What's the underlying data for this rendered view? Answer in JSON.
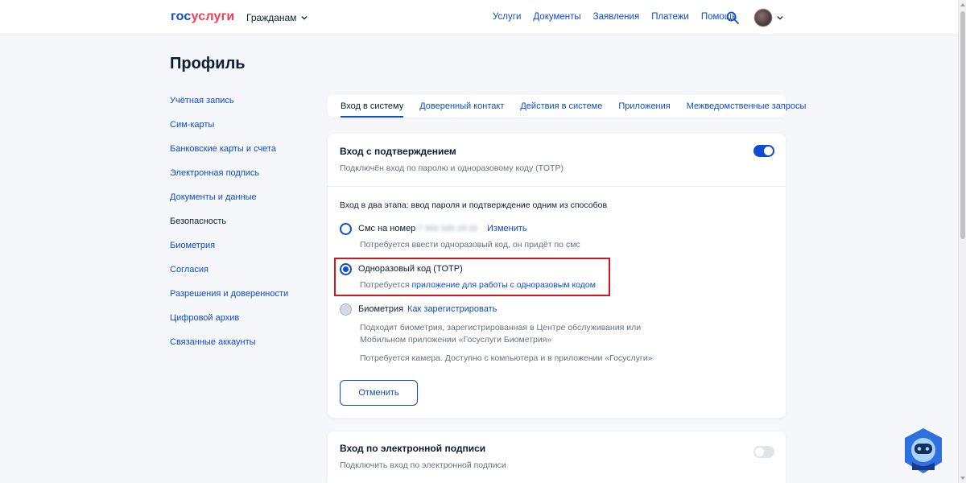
{
  "header": {
    "logo_part1": "гос",
    "logo_part2": "услуги",
    "audience": "Гражданам",
    "nav": [
      "Услуги",
      "Документы",
      "Заявления",
      "Платежи",
      "Помощь"
    ],
    "icons": {
      "search": "search-icon",
      "chevron": "chevron-down-icon",
      "avatar": "avatar"
    }
  },
  "page": {
    "title": "Профиль"
  },
  "sidebar": {
    "items": [
      "Учётная запись",
      "Сим-карты",
      "Банковские карты и счета",
      "Электронная подпись",
      "Документы и данные",
      "Безопасность",
      "Биометрия",
      "Согласия",
      "Разрешения и доверенности",
      "Цифровой архив",
      "Связанные аккаунты"
    ],
    "active_index": 5
  },
  "tabs": [
    "Вход в систему",
    "Доверенный контакт",
    "Действия в системе",
    "Приложения",
    "Межведомственные запросы"
  ],
  "active_tab": 0,
  "two_factor": {
    "title": "Вход с подтверждением",
    "subtitle": "Подключён вход по паролю и одноразовому коду (TOTP)",
    "enabled": true,
    "intro": "Вход в два этапа: ввод пароля и подтверждение одним из способов",
    "sms": {
      "label": "Смс на номер",
      "phone": "+7 900 349-18-33",
      "change_link": "Изменить",
      "note": "Потребуется ввести одноразовый код, он придёт по смс"
    },
    "totp": {
      "label": "Одноразовый код (TOTP)",
      "note_prefix": "Потребуется",
      "note_link": "приложение для работы с одноразовым кодом",
      "selected": true
    },
    "biometry": {
      "label": "Биометрия",
      "register_link": "Как зарегистрировать",
      "note_line1": "Подходит биометрия, зарегистрированная в Центре обслуживания или",
      "note_line2": "Мобильном приложении «Госуслуги Биометрия»",
      "note_line3": "Потребуется камера. Доступно с компьютера и в приложении «Госуслуги»"
    },
    "cancel_button": "Отменить"
  },
  "esign_login": {
    "title": "Вход по электронной подписи",
    "subtitle": "Подключить вход по электронной подписи",
    "enabled": false
  },
  "colors": {
    "accent": "#0d4cd3",
    "logo_red": "#ee3f58",
    "highlight": "#d4141e",
    "background": "#f5f7fa"
  }
}
